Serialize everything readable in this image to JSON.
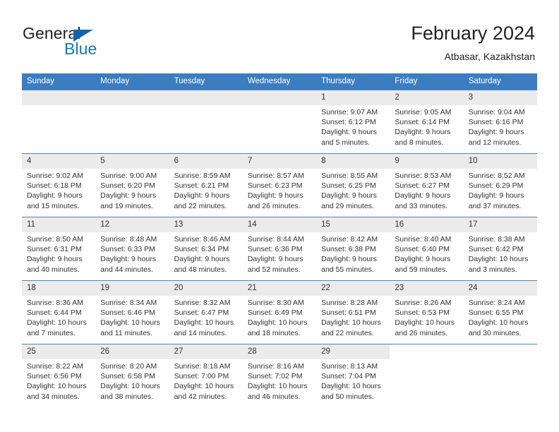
{
  "brand": {
    "name_top": "General",
    "name_bottom": "Blue",
    "color_top": "#231f20",
    "color_bottom": "#1b75bc",
    "triangle_color": "#1463ad"
  },
  "header": {
    "title": "February 2024",
    "location": "Atbasar, Kazakhstan"
  },
  "theme": {
    "header_row_bg": "#3b7dc0",
    "header_row_text": "#ffffff",
    "daynum_bg": "#ebebeb",
    "row_divider": "#4a86c5",
    "cell_bg": "#ffffff",
    "text": "#333333"
  },
  "weekdays": [
    "Sunday",
    "Monday",
    "Tuesday",
    "Wednesday",
    "Thursday",
    "Friday",
    "Saturday"
  ],
  "labels": {
    "sunrise": "Sunrise:",
    "sunset": "Sunset:",
    "daylight": "Daylight:"
  },
  "weeks": [
    [
      {
        "day": "",
        "sunrise": "",
        "sunset": "",
        "daylight": "",
        "empty": true
      },
      {
        "day": "",
        "sunrise": "",
        "sunset": "",
        "daylight": "",
        "empty": true
      },
      {
        "day": "",
        "sunrise": "",
        "sunset": "",
        "daylight": "",
        "empty": true
      },
      {
        "day": "",
        "sunrise": "",
        "sunset": "",
        "daylight": "",
        "empty": true
      },
      {
        "day": "1",
        "sunrise": "Sunrise: 9:07 AM",
        "sunset": "Sunset: 6:12 PM",
        "daylight": "Daylight: 9 hours and 5 minutes."
      },
      {
        "day": "2",
        "sunrise": "Sunrise: 9:05 AM",
        "sunset": "Sunset: 6:14 PM",
        "daylight": "Daylight: 9 hours and 8 minutes."
      },
      {
        "day": "3",
        "sunrise": "Sunrise: 9:04 AM",
        "sunset": "Sunset: 6:16 PM",
        "daylight": "Daylight: 9 hours and 12 minutes."
      }
    ],
    [
      {
        "day": "4",
        "sunrise": "Sunrise: 9:02 AM",
        "sunset": "Sunset: 6:18 PM",
        "daylight": "Daylight: 9 hours and 15 minutes."
      },
      {
        "day": "5",
        "sunrise": "Sunrise: 9:00 AM",
        "sunset": "Sunset: 6:20 PM",
        "daylight": "Daylight: 9 hours and 19 minutes."
      },
      {
        "day": "6",
        "sunrise": "Sunrise: 8:59 AM",
        "sunset": "Sunset: 6:21 PM",
        "daylight": "Daylight: 9 hours and 22 minutes."
      },
      {
        "day": "7",
        "sunrise": "Sunrise: 8:57 AM",
        "sunset": "Sunset: 6:23 PM",
        "daylight": "Daylight: 9 hours and 26 minutes."
      },
      {
        "day": "8",
        "sunrise": "Sunrise: 8:55 AM",
        "sunset": "Sunset: 6:25 PM",
        "daylight": "Daylight: 9 hours and 29 minutes."
      },
      {
        "day": "9",
        "sunrise": "Sunrise: 8:53 AM",
        "sunset": "Sunset: 6:27 PM",
        "daylight": "Daylight: 9 hours and 33 minutes."
      },
      {
        "day": "10",
        "sunrise": "Sunrise: 8:52 AM",
        "sunset": "Sunset: 6:29 PM",
        "daylight": "Daylight: 9 hours and 37 minutes."
      }
    ],
    [
      {
        "day": "11",
        "sunrise": "Sunrise: 8:50 AM",
        "sunset": "Sunset: 6:31 PM",
        "daylight": "Daylight: 9 hours and 40 minutes."
      },
      {
        "day": "12",
        "sunrise": "Sunrise: 8:48 AM",
        "sunset": "Sunset: 6:33 PM",
        "daylight": "Daylight: 9 hours and 44 minutes."
      },
      {
        "day": "13",
        "sunrise": "Sunrise: 8:46 AM",
        "sunset": "Sunset: 6:34 PM",
        "daylight": "Daylight: 9 hours and 48 minutes."
      },
      {
        "day": "14",
        "sunrise": "Sunrise: 8:44 AM",
        "sunset": "Sunset: 6:36 PM",
        "daylight": "Daylight: 9 hours and 52 minutes."
      },
      {
        "day": "15",
        "sunrise": "Sunrise: 8:42 AM",
        "sunset": "Sunset: 6:38 PM",
        "daylight": "Daylight: 9 hours and 55 minutes."
      },
      {
        "day": "16",
        "sunrise": "Sunrise: 8:40 AM",
        "sunset": "Sunset: 6:40 PM",
        "daylight": "Daylight: 9 hours and 59 minutes."
      },
      {
        "day": "17",
        "sunrise": "Sunrise: 8:38 AM",
        "sunset": "Sunset: 6:42 PM",
        "daylight": "Daylight: 10 hours and 3 minutes."
      }
    ],
    [
      {
        "day": "18",
        "sunrise": "Sunrise: 8:36 AM",
        "sunset": "Sunset: 6:44 PM",
        "daylight": "Daylight: 10 hours and 7 minutes."
      },
      {
        "day": "19",
        "sunrise": "Sunrise: 8:34 AM",
        "sunset": "Sunset: 6:46 PM",
        "daylight": "Daylight: 10 hours and 11 minutes."
      },
      {
        "day": "20",
        "sunrise": "Sunrise: 8:32 AM",
        "sunset": "Sunset: 6:47 PM",
        "daylight": "Daylight: 10 hours and 14 minutes."
      },
      {
        "day": "21",
        "sunrise": "Sunrise: 8:30 AM",
        "sunset": "Sunset: 6:49 PM",
        "daylight": "Daylight: 10 hours and 18 minutes."
      },
      {
        "day": "22",
        "sunrise": "Sunrise: 8:28 AM",
        "sunset": "Sunset: 6:51 PM",
        "daylight": "Daylight: 10 hours and 22 minutes."
      },
      {
        "day": "23",
        "sunrise": "Sunrise: 8:26 AM",
        "sunset": "Sunset: 6:53 PM",
        "daylight": "Daylight: 10 hours and 26 minutes."
      },
      {
        "day": "24",
        "sunrise": "Sunrise: 8:24 AM",
        "sunset": "Sunset: 6:55 PM",
        "daylight": "Daylight: 10 hours and 30 minutes."
      }
    ],
    [
      {
        "day": "25",
        "sunrise": "Sunrise: 8:22 AM",
        "sunset": "Sunset: 6:56 PM",
        "daylight": "Daylight: 10 hours and 34 minutes."
      },
      {
        "day": "26",
        "sunrise": "Sunrise: 8:20 AM",
        "sunset": "Sunset: 6:58 PM",
        "daylight": "Daylight: 10 hours and 38 minutes."
      },
      {
        "day": "27",
        "sunrise": "Sunrise: 8:18 AM",
        "sunset": "Sunset: 7:00 PM",
        "daylight": "Daylight: 10 hours and 42 minutes."
      },
      {
        "day": "28",
        "sunrise": "Sunrise: 8:16 AM",
        "sunset": "Sunset: 7:02 PM",
        "daylight": "Daylight: 10 hours and 46 minutes."
      },
      {
        "day": "29",
        "sunrise": "Sunrise: 8:13 AM",
        "sunset": "Sunset: 7:04 PM",
        "daylight": "Daylight: 10 hours and 50 minutes."
      },
      {
        "day": "",
        "sunrise": "",
        "sunset": "",
        "daylight": "",
        "blank": true
      },
      {
        "day": "",
        "sunrise": "",
        "sunset": "",
        "daylight": "",
        "blank": true
      }
    ]
  ]
}
